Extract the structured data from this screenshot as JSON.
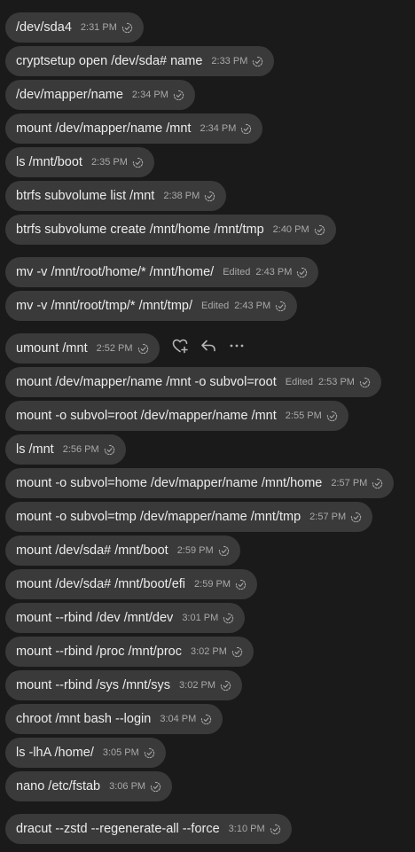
{
  "messages": [
    {
      "text": "/dev/sda4",
      "time": "2:31 PM",
      "edited": ""
    },
    {
      "text": "cryptsetup open /dev/sda# name",
      "time": "2:33 PM",
      "edited": ""
    },
    {
      "text": "/dev/mapper/name",
      "time": "2:34 PM",
      "edited": ""
    },
    {
      "text": "mount /dev/mapper/name /mnt",
      "time": "2:34 PM",
      "edited": ""
    },
    {
      "text": "ls /mnt/boot",
      "time": "2:35 PM",
      "edited": ""
    },
    {
      "text": "btrfs subvolume list /mnt",
      "time": "2:38 PM",
      "edited": ""
    },
    {
      "text": "btrfs subvolume create /mnt/home /mnt/tmp",
      "time": "2:40 PM",
      "edited": ""
    },
    {
      "text": "mv -v /mnt/root/home/* /mnt/home/",
      "time": "2:43 PM",
      "edited": "Edited"
    },
    {
      "text": "mv -v /mnt/root/tmp/* /mnt/tmp/",
      "time": "2:43 PM",
      "edited": "Edited"
    },
    {
      "text": "umount /mnt",
      "time": "2:52 PM",
      "edited": ""
    },
    {
      "text": "mount /dev/mapper/name /mnt -o subvol=root",
      "time": "2:53 PM",
      "edited": "Edited"
    },
    {
      "text": "mount -o subvol=root /dev/mapper/name /mnt",
      "time": "2:55 PM",
      "edited": ""
    },
    {
      "text": "ls /mnt",
      "time": "2:56 PM",
      "edited": ""
    },
    {
      "text": "mount -o subvol=home /dev/mapper/name /mnt/home",
      "time": "2:57 PM",
      "edited": ""
    },
    {
      "text": "mount -o subvol=tmp /dev/mapper/name /mnt/tmp",
      "time": "2:57 PM",
      "edited": ""
    },
    {
      "text": "mount /dev/sda# /mnt/boot",
      "time": "2:59 PM",
      "edited": ""
    },
    {
      "text": "mount /dev/sda# /mnt/boot/efi",
      "time": "2:59 PM",
      "edited": ""
    },
    {
      "text": "mount --rbind /dev /mnt/dev",
      "time": "3:01 PM",
      "edited": ""
    },
    {
      "text": "mount --rbind /proc /mnt/proc",
      "time": "3:02 PM",
      "edited": ""
    },
    {
      "text": "mount --rbind /sys /mnt/sys",
      "time": "3:02 PM",
      "edited": ""
    },
    {
      "text": "chroot /mnt bash --login",
      "time": "3:04 PM",
      "edited": ""
    },
    {
      "text": "ls -lhA /home/",
      "time": "3:05 PM",
      "edited": ""
    },
    {
      "text": "nano /etc/fstab",
      "time": "3:06 PM",
      "edited": ""
    },
    {
      "text": "dracut --zstd --regenerate-all --force",
      "time": "3:10 PM",
      "edited": ""
    }
  ],
  "hover_actions": {
    "icons": [
      "add-reaction-icon",
      "reply-icon",
      "more-options-icon"
    ]
  }
}
